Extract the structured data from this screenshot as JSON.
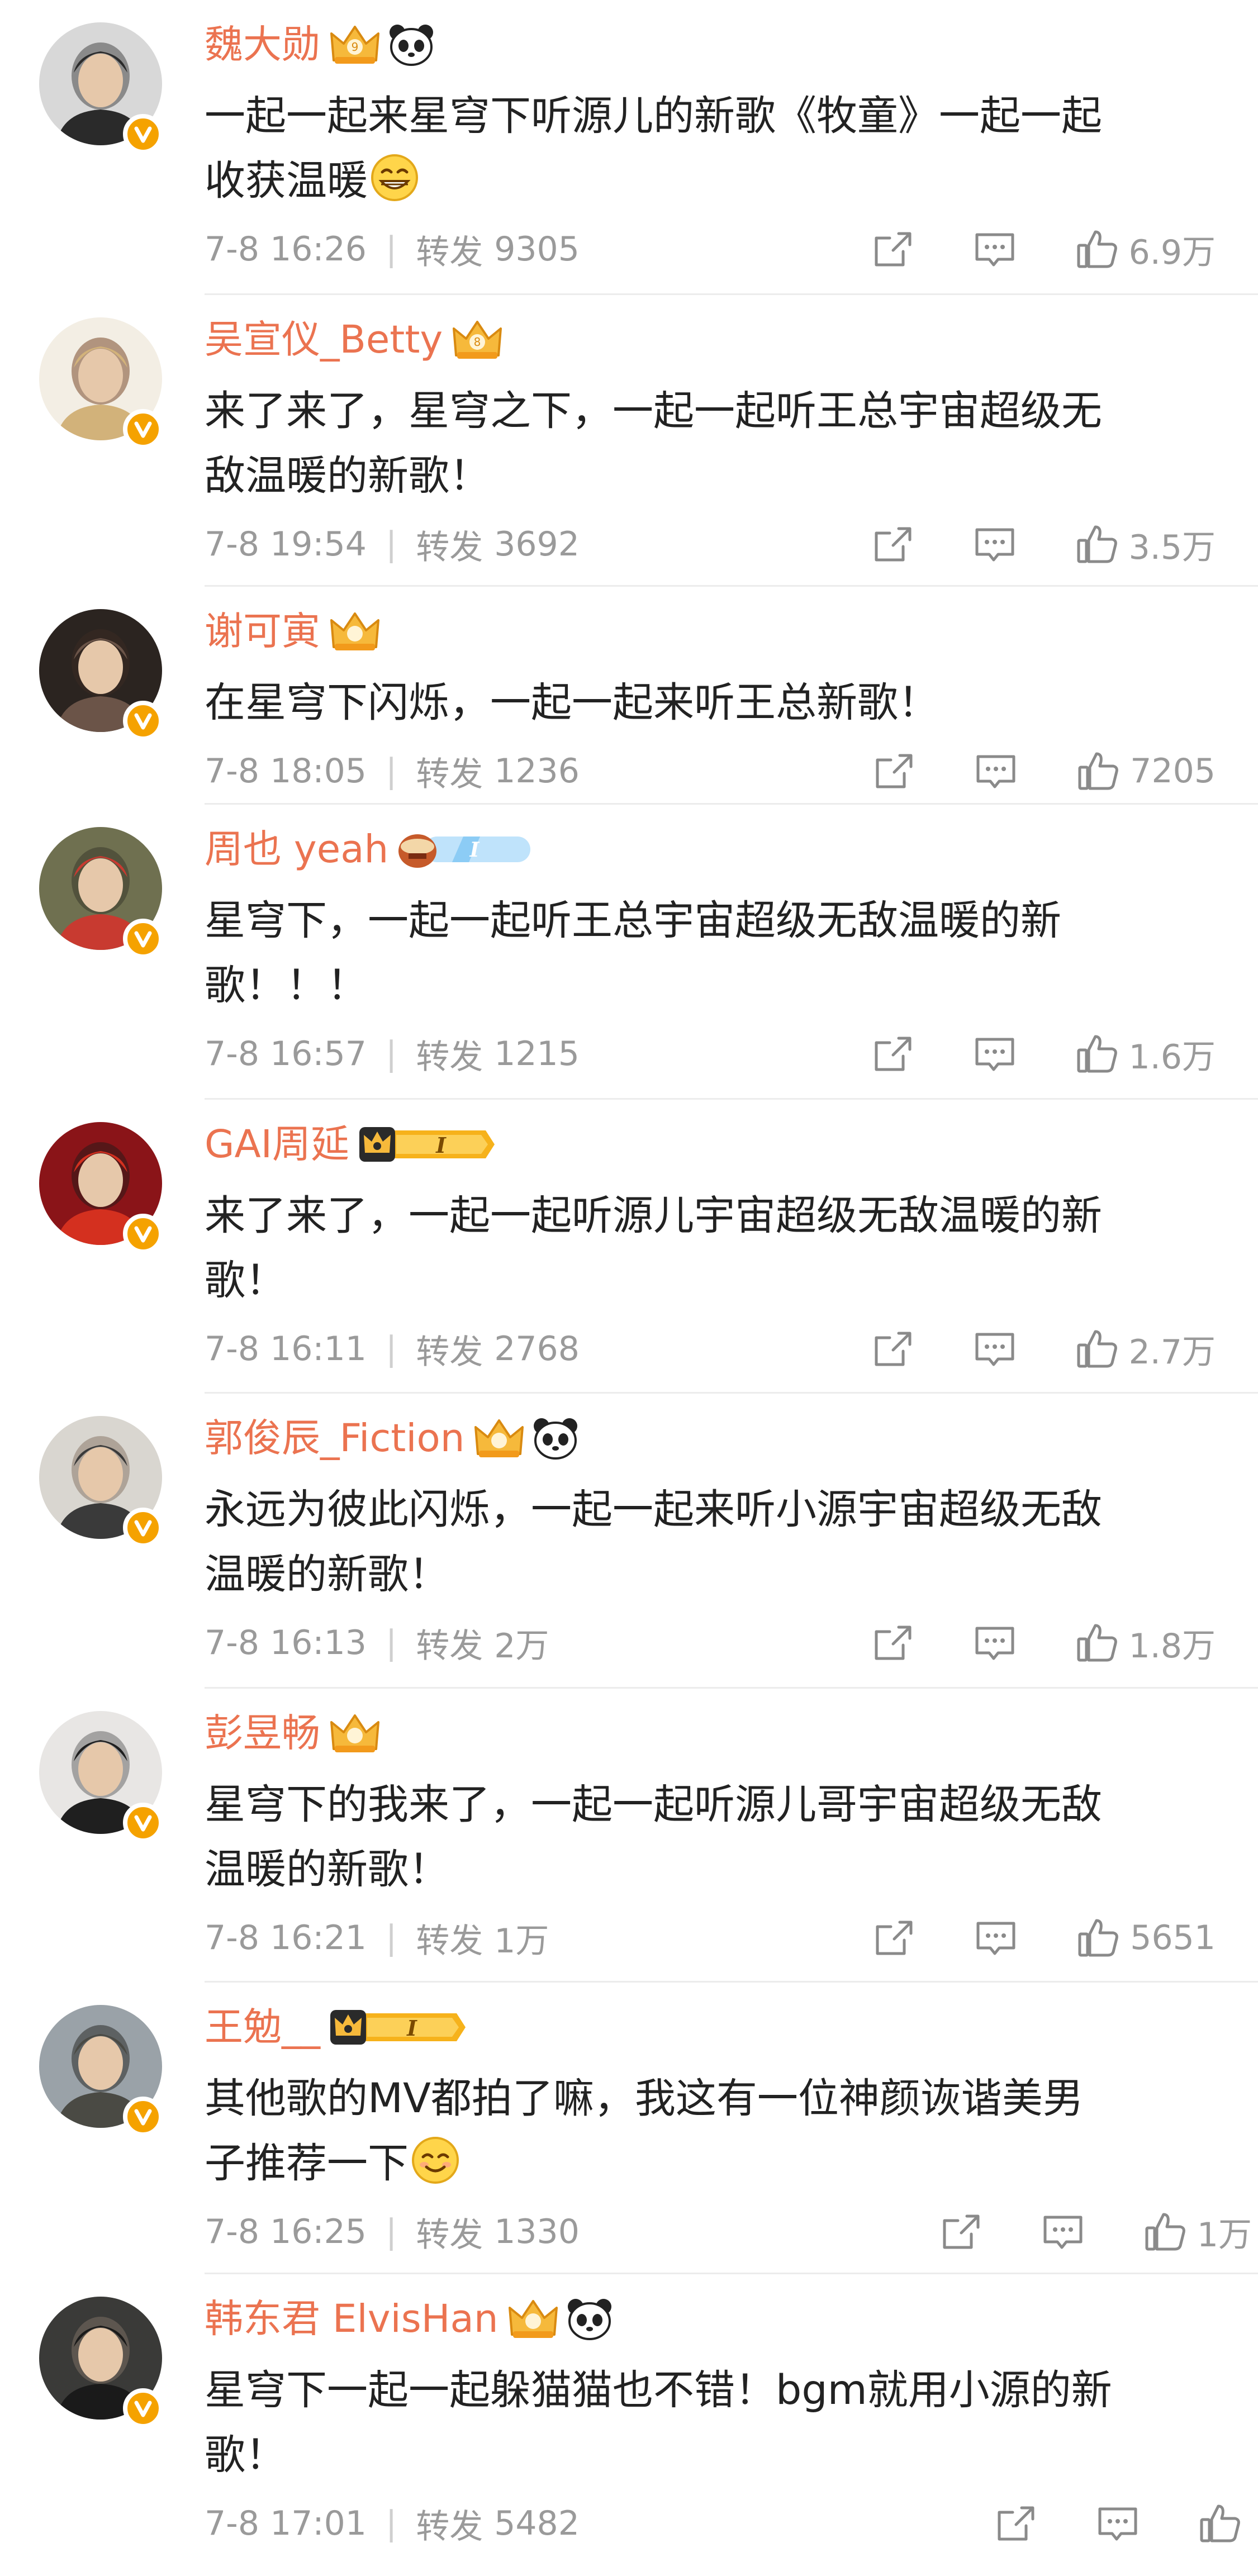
{
  "comments": [
    {
      "user": "魏大勋",
      "badges": [
        "crown-9",
        "panda"
      ],
      "text": "一起一起来星穹下听源儿的新歌《牧童》一起一起\n收获温暖",
      "emoji": "grin-face",
      "time": "7-8 16:26",
      "repost_label": "转发",
      "reposts": "9305",
      "likes": "6.9万"
    },
    {
      "user": "吴宣仪_Betty",
      "badges": [
        "crown-8"
      ],
      "text": "来了来了，星穹之下，一起一起听王总宇宙超级无\n敌温暖的新歌！",
      "emoji": "",
      "time": "7-8 19:54",
      "repost_label": "转发",
      "reposts": "3692",
      "likes": "3.5万"
    },
    {
      "user": "谢可寅",
      "badges": [
        "crown"
      ],
      "text": "在星穹下闪烁，一起一起来听王总新歌！",
      "emoji": "",
      "time": "7-8 18:05",
      "repost_label": "转发",
      "reposts": "1236",
      "likes": "7205"
    },
    {
      "user": "周也 yeah",
      "badges": [
        "drum-level-blue"
      ],
      "text": "星穹下，一起一起听王总宇宙超级无敌温暖的新\n歌！！！",
      "emoji": "",
      "time": "7-8 16:57",
      "repost_label": "转发",
      "reposts": "1215",
      "likes": "1.6万"
    },
    {
      "user": "GAI周延",
      "badges": [
        "level-gold"
      ],
      "text": "来了来了，一起一起听源儿宇宙超级无敌温暖的新\n歌！",
      "emoji": "",
      "time": "7-8 16:11",
      "repost_label": "转发",
      "reposts": "2768",
      "likes": "2.7万"
    },
    {
      "user": "郭俊辰_Fiction",
      "badges": [
        "crown",
        "panda"
      ],
      "text": "永远为彼此闪烁，一起一起来听小源宇宙超级无敌\n温暖的新歌！",
      "emoji": "",
      "time": "7-8 16:13",
      "repost_label": "转发",
      "reposts": "2万",
      "likes": "1.8万"
    },
    {
      "user": "彭昱畅",
      "badges": [
        "crown"
      ],
      "text": "星穹下的我来了，一起一起听源儿哥宇宙超级无敌\n温暖的新歌！",
      "emoji": "",
      "time": "7-8 16:21",
      "repost_label": "转发",
      "reposts": "1万",
      "likes": "5651"
    },
    {
      "user": "王勉__",
      "badges": [
        "level-gold"
      ],
      "text": "其他歌的MV都拍了嘛，我这有一位神颜诙谐美男\n子推荐一下",
      "emoji": "smile-face",
      "time": "7-8 16:25",
      "repost_label": "转发",
      "reposts": "1330",
      "likes": "1万"
    },
    {
      "user": "韩东君 ElvisHan",
      "badges": [
        "crown",
        "panda"
      ],
      "text": "星穹下一起一起躲猫猫也不错！bgm就用小源的新\n歌！",
      "emoji": "",
      "time": "7-8 17:01",
      "repost_label": "转发",
      "reposts": "5482",
      "likes": ""
    }
  ],
  "icons": {
    "share": "share-icon",
    "comment": "comment-icon",
    "like": "thumbs-up-icon",
    "verified": "verified-v-icon"
  },
  "colors": {
    "username": "#eb7350",
    "text": "#222222",
    "meta": "#9a9a9a",
    "verified": "#f5a200"
  }
}
